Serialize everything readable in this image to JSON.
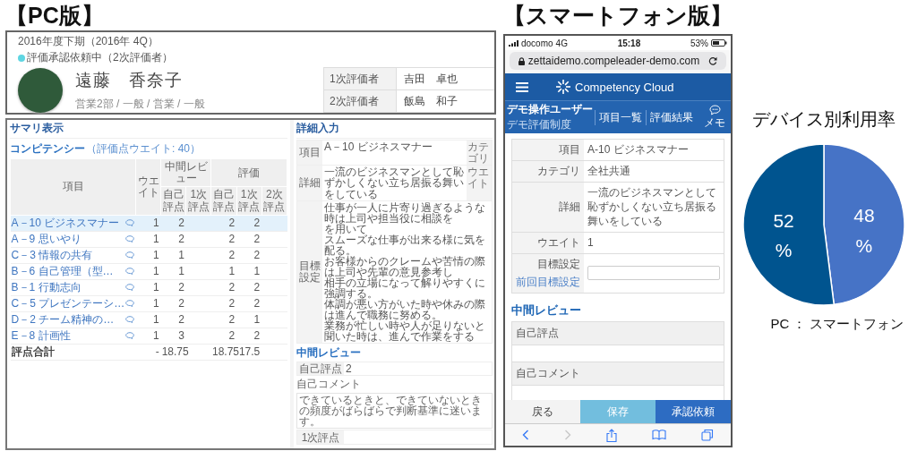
{
  "pc": {
    "heading": "【PC版】",
    "profile": {
      "period": "2016年度下期（2016年 4Q）",
      "status": {
        "text": "評価承認依頼中（2次評価者）",
        "color": "#5fd6e2"
      },
      "name": "遠藤　香奈子",
      "affiliation": "営業2部 / 一般 / 営業 / 一般",
      "evaluators": [
        {
          "label": "1次評価者",
          "name": "吉田　卓也"
        },
        {
          "label": "2次評価者",
          "name": "飯島　和子"
        }
      ]
    },
    "summary": {
      "title": "サマリ表示",
      "section": "コンピテンシー",
      "section_note": "（評価点ウエイト: 40）",
      "column_groups": [
        "中間レビュー",
        "評価"
      ],
      "columns": [
        "項目",
        "ウエイト",
        "自己評点",
        "1次評点",
        "自己評点",
        "1次評点",
        "2次評点"
      ],
      "rows": [
        {
          "selected": true,
          "cells": [
            "A－10 ビジネスマナー",
            "1",
            "2",
            "",
            "2",
            "2",
            ""
          ]
        },
        {
          "selected": false,
          "cells": [
            "A－9 思いやり",
            "1",
            "2",
            "",
            "2",
            "2",
            ""
          ]
        },
        {
          "selected": false,
          "cells": [
            "C－3 情報の共有",
            "1",
            "1",
            "",
            "2",
            "2",
            ""
          ]
        },
        {
          "selected": false,
          "cells": [
            "B－6 自己管理（型…",
            "1",
            "1",
            "",
            "1",
            "1",
            ""
          ]
        },
        {
          "selected": false,
          "cells": [
            "B－1 行動志向",
            "1",
            "2",
            "",
            "2",
            "2",
            ""
          ]
        },
        {
          "selected": false,
          "cells": [
            "C－5 プレゼンテーシ…",
            "1",
            "2",
            "",
            "2",
            "2",
            ""
          ]
        },
        {
          "selected": false,
          "cells": [
            "D－2 チーム精神の…",
            "1",
            "2",
            "",
            "2",
            "1",
            ""
          ]
        },
        {
          "selected": false,
          "cells": [
            "E－8 計画性",
            "1",
            "3",
            "",
            "2",
            "2",
            ""
          ]
        }
      ],
      "total": {
        "cells": [
          "評点合計",
          "-",
          "18.75",
          "",
          "18.75",
          "17.5",
          ""
        ]
      }
    },
    "detail": {
      "title": "詳細入力",
      "item_label": "項目",
      "item": "A－10 ビジネスマナー",
      "category_label": "カテゴリ",
      "detail_label": "詳細",
      "detail": "一流のビジネスマンとして恥ずかしくない立ち居振る舞いをしている",
      "weight_label": "ウエイト",
      "goal_label": "目標設定",
      "goal_lines": [
        "仕事が一人に片寄り過ぎるような時は上司や担当役に相談を",
        "を用いて",
        "スムーズな仕事が出来る様に気を配る。",
        "お客様からのクレームや苦情の際は上司や先輩の意見参考し",
        "相手の立場になって解りやすくに強調する。",
        "体調が悪い方がいた時や休みの際は進んで職務に努める。",
        "業務が忙しい時や人が足りないと聞いた時は、進んで作業をする"
      ],
      "review": {
        "title": "中間レビュー",
        "self_score_label": "自己評点",
        "self_score": "2",
        "comment_label": "自己コメント",
        "comment": "できているときと、できていないときの頻度がばらばらで判断基準に迷います。",
        "first_score_label": "1次評点"
      }
    }
  },
  "phone": {
    "heading": "【スマートフォン版】",
    "status_bar": {
      "carrier": "docomo",
      "network": "4G",
      "time": "15:18",
      "battery": "53%"
    },
    "url": "zettaidemo.compeleader-demo.com",
    "app_title": "Competency Cloud",
    "user": {
      "name": "デモ操作ユーザー",
      "system": "デモ評価制度"
    },
    "nav": [
      {
        "label": "項目一覧",
        "kind": "text"
      },
      {
        "label": "評価結果",
        "kind": "text"
      },
      {
        "label": "メモ",
        "kind": "icon"
      }
    ],
    "detail_rows": [
      {
        "label": "項目",
        "kind": "text",
        "value": "A-10 ビジネスマナー"
      },
      {
        "label": "カテゴリ",
        "kind": "text",
        "value": "全社共通"
      },
      {
        "label": "詳細",
        "kind": "text",
        "value": "一流のビジネスマンとして恥ずかしくない立ち居振る舞いをしている"
      },
      {
        "label": "ウエイト",
        "kind": "text",
        "value": "1"
      },
      {
        "label": "目標設定",
        "kind": "input",
        "link": "前回目標設定"
      }
    ],
    "review_title": "中間レビュー",
    "review_rows": [
      {
        "label": "自己評点"
      },
      {
        "label": "自己コメント"
      }
    ],
    "buttons": [
      {
        "label": "戻る",
        "kind": "back"
      },
      {
        "label": "保存",
        "kind": "save"
      },
      {
        "label": "承認依頼",
        "kind": "primary"
      }
    ]
  },
  "chart": {
    "chart_data": {
      "type": "pie",
      "title": "デバイス別利用率",
      "categories": [
        "PC",
        "スマートフォン"
      ],
      "values": [
        52,
        48
      ],
      "value_labels": [
        "52 %",
        "48 %"
      ]
    },
    "legend_separator": "："
  }
}
